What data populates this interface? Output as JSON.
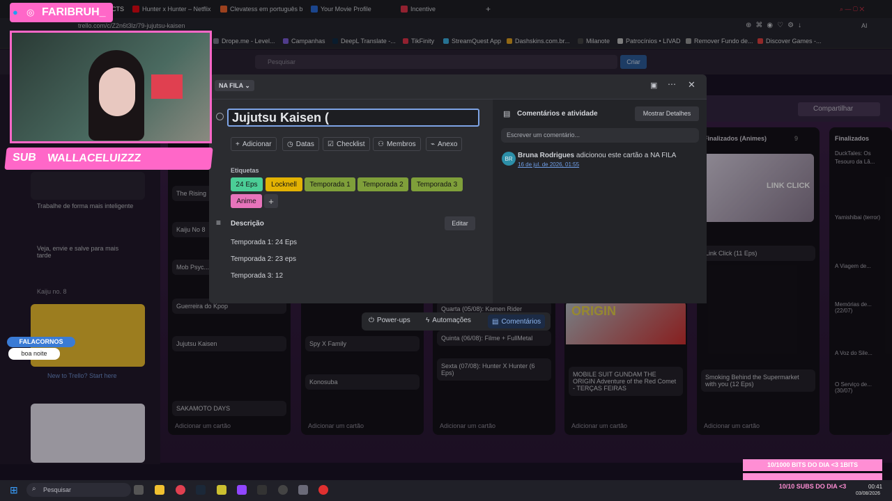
{
  "browser": {
    "tabs": [
      {
        "label": "Hunter x Hunter – Netflix",
        "color": "#e50914"
      },
      {
        "label": "Clevatess em português b",
        "color": "#f0652f"
      },
      {
        "label": "Your Movie Profile",
        "color": "#2a6ad8"
      },
      {
        "label": "Incentive",
        "color": "#e0334b"
      }
    ],
    "partial_tab": "CTS",
    "url": "trello.com/c/Z2n6t3lz/79-jujutsu-kaisen",
    "bookmarks": [
      "Drope.me - Level...",
      "Campanhas",
      "DeepL Translate -...",
      "TikFinity",
      "StreamQuest App",
      "Dashskins.com.br...",
      "Milanote",
      "Patrocínios • LIVAD",
      "Remover Fundo de...",
      "Discover Games -..."
    ],
    "ai_label": "AI"
  },
  "trello": {
    "search_placeholder": "Pesquisar",
    "create_label": "Criar",
    "share_label": "Compartilhar",
    "left_cards": [
      "Trabalhe de forma mais inteligente",
      "Veja, envie e salve para mais tarde",
      "Kaiju no. 8",
      "New to Trello? Start here"
    ],
    "columns": [
      {
        "cards": [
          "The Rising",
          "Kaiju No 8",
          "Mob Psyc...",
          "Guerreira do Kpop",
          "Jujutsu Kaisen",
          "SAKAMOTO DAYS"
        ]
      },
      {
        "cards": [
          "Spy X Family",
          "Konosuba"
        ]
      },
      {
        "cards": [
          "Quarta (05/08): Kamen Rider",
          "Quinta (06/08): Filme + FullMetal",
          "Sexta (07/08): Hunter X Hunter (6 Eps)"
        ]
      },
      {
        "cards": [
          "MOBILE SUIT GUNDAM THE ORIGIN Adventure of the Red Comet - TERÇAS FEIRAS"
        ],
        "banner": "ORIGIN"
      },
      {
        "title": "Finalizados (Animes)",
        "count": "9",
        "cards": [
          "Link Click (11 Eps)",
          "Smoking Behind the Supermarket with you (12 Eps)"
        ],
        "banner": "LINK CLICK"
      },
      {
        "title": "Finalizados",
        "cards": [
          "DuckTales: Os Tesouro da Lâ...",
          "Yamishibai (terror)",
          "A Viagem de...",
          "Memórias de... (22/07)",
          "A Voz do Sile...",
          "O Serviço de... (30/07)"
        ]
      }
    ],
    "add_card_label": "Adicionar um cartão"
  },
  "modal": {
    "list_name": "NA FILA",
    "title": "Jujutsu Kaisen (",
    "actions": [
      "Adicionar",
      "Datas",
      "Checklist",
      "Membros",
      "Anexo"
    ],
    "labels_heading": "Etiquetas",
    "labels": [
      {
        "text": "24 Eps",
        "color": "#4bce97"
      },
      {
        "text": "Locknell",
        "color": "#e2b203"
      },
      {
        "text": "Temporada 1",
        "color": "#7f9f3a"
      },
      {
        "text": "Temporada 2",
        "color": "#7f9f3a"
      },
      {
        "text": "Temporada 3",
        "color": "#7f9f3a"
      },
      {
        "text": "Anime",
        "color": "#e774bb"
      }
    ],
    "description_heading": "Descrição",
    "edit_label": "Editar",
    "description_lines": [
      "Temporada 1: 24 Eps",
      "Temporada 2: 23 eps",
      "Temporada 3: 12"
    ],
    "comments_heading": "Comentários e atividade",
    "show_details_label": "Mostrar Detalhes",
    "comment_placeholder": "Escrever um comentário...",
    "activity": {
      "avatar": "BR",
      "user": "Bruna Rodrigues",
      "text": " adicionou este cartão a NA FILA",
      "time": "16 de jul. de 2026, 01:55"
    }
  },
  "bottom_bar": {
    "items": [
      "Power-ups",
      "Automações",
      "Comentários"
    ]
  },
  "stream_overlay": {
    "handle": "FARIBRUH_",
    "sub_tag": "SUB",
    "sub_name": "WALLACELUIZZZ",
    "chat_user": "FALACORNOS",
    "chat_msg": "boa noite",
    "bits_goal": "10/1000 BITS DO DIA <3 1BITS",
    "subs_goal": "10/10 SUBS DO DIA <3"
  },
  "taskbar": {
    "search_placeholder": "Pesquisar",
    "time": "00:41",
    "date": "03/08/2026"
  },
  "colors": {
    "accent": "#7ea4e6",
    "overlay_pink": "#ff67c8"
  }
}
